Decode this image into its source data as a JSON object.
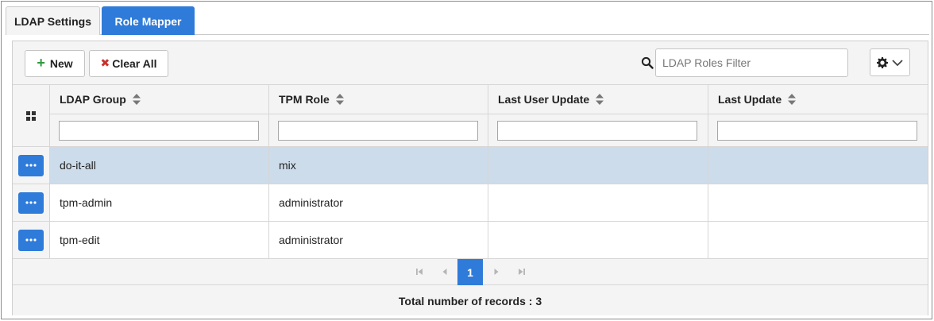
{
  "tabs": [
    {
      "label": "LDAP Settings",
      "active": false
    },
    {
      "label": "Role Mapper",
      "active": true
    }
  ],
  "toolbar": {
    "new_label": "New",
    "clear_all_label": "Clear All",
    "filter_placeholder": "LDAP Roles Filter",
    "filter_value": ""
  },
  "columns": [
    "LDAP Group",
    "TPM Role",
    "Last User Update",
    "Last Update"
  ],
  "rows": [
    {
      "ldap_group": "do-it-all",
      "tpm_role": "mix",
      "last_user_update": "",
      "last_update": "",
      "selected": true
    },
    {
      "ldap_group": "tpm-admin",
      "tpm_role": "administrator",
      "last_user_update": "",
      "last_update": "",
      "selected": false
    },
    {
      "ldap_group": "tpm-edit",
      "tpm_role": "administrator",
      "last_user_update": "",
      "last_update": "",
      "selected": false
    }
  ],
  "pager": {
    "current_page": "1"
  },
  "footer": {
    "total_label": "Total number of records : 3"
  },
  "colors": {
    "accent": "#2f7bd9",
    "selected_row": "#cddcea",
    "add_green": "#2e9b3e",
    "clear_red": "#c8322c"
  },
  "icons": [
    "plus-icon",
    "x-icon",
    "search-icon",
    "gear-icon",
    "chevron-down-icon",
    "grid-icon",
    "sort-icon",
    "ellipsis-icon",
    "first-page-icon",
    "prev-page-icon",
    "next-page-icon",
    "last-page-icon"
  ]
}
